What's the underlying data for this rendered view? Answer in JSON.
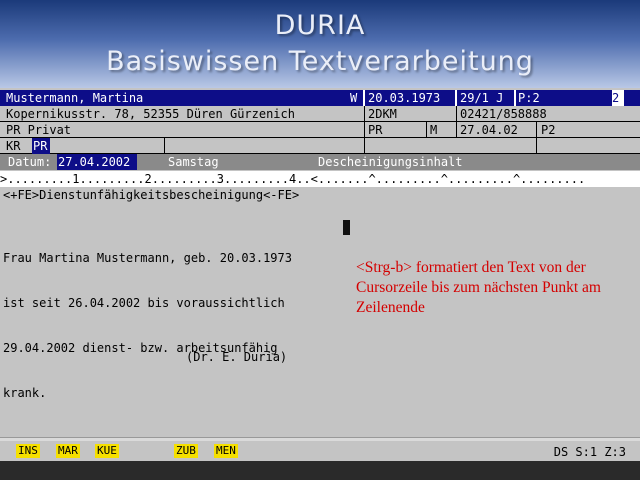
{
  "title": {
    "line1": "DURIA",
    "line2": "Basiswissen Textverarbeitung"
  },
  "patient": {
    "name": "Mustermann, Martina",
    "sex": "W",
    "dob": "20.03.1973",
    "age": "29/1 J",
    "page": "P:2",
    "counter": "2",
    "address": "Kopernikusstr. 78, 52355 Düren Gürzenich",
    "code": "2DKM",
    "phone": "02421/858888",
    "insurance": "PR Privat",
    "ins_short": "PR",
    "ins_flag": "M",
    "ins_date": "27.04.02",
    "ins_extra": "P2",
    "kr_label": "KR",
    "kr_value": "PR"
  },
  "datum_bar": {
    "label": "Datum:",
    "date": "27.04.2002",
    "weekday": "Samstag",
    "heading": "Descheinigungsinhalt"
  },
  "ruler": ">.........1.........2.........3.........4..<.......^.........^.........^.........",
  "fe_line": "<+FE>Dienstunfähigkeitsbescheinigung<-FE>",
  "body_lines": [
    "Frau Martina Mustermann, geb. 20.03.1973",
    "ist seit 26.04.2002 bis voraussichtlich",
    "29.04.2002 dienst- bzw. arbeitsunfähig",
    "krank."
  ],
  "signature": "(Dr. E. Duria)",
  "tip": "<Strg-b> formatiert den Text von der Cursorzeile bis zum nächsten Punkt am Zeilenende",
  "status": {
    "keys": [
      "INS",
      "MAR",
      "KUE",
      "ZUB",
      "MEN"
    ],
    "right": "DS S:1 Z:3"
  },
  "colors": {
    "header_bg": "#0d0d88",
    "tip_text": "#d40000",
    "fkey_bg": "#f5e000",
    "screen_bg": "#c4c4c4"
  }
}
